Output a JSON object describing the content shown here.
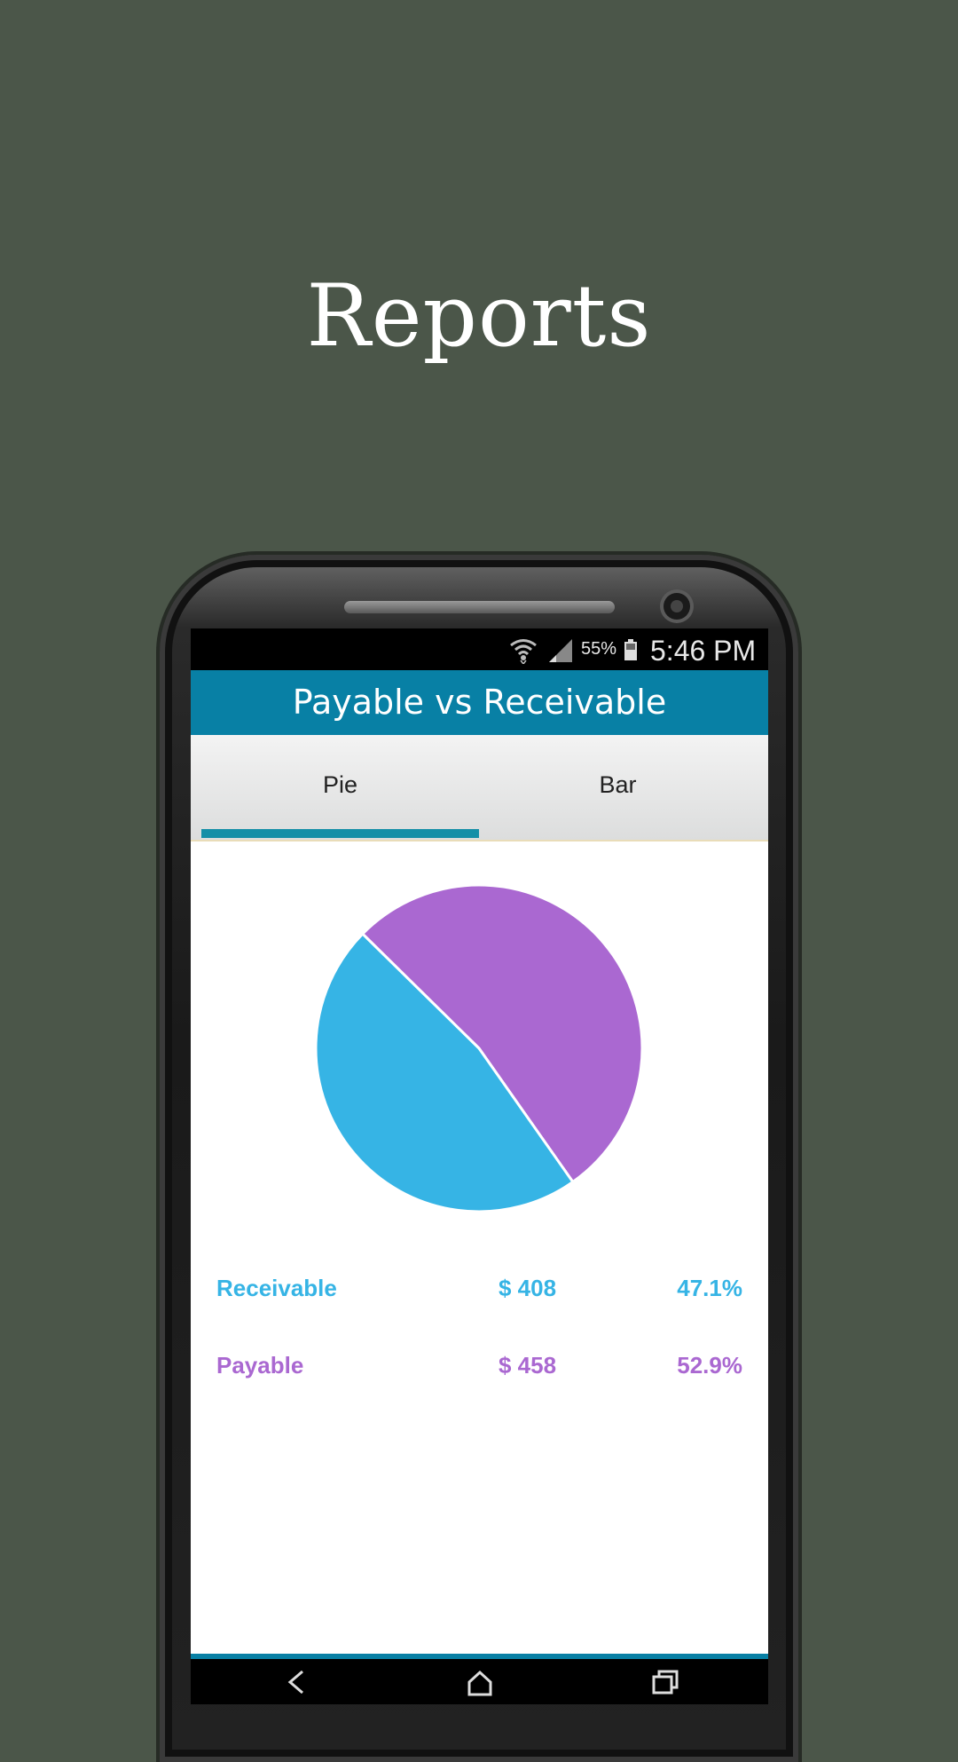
{
  "promo": {
    "title": "Reports"
  },
  "status_bar": {
    "battery": "55%",
    "time": "5:46 PM"
  },
  "app_bar": {
    "title": "Payable vs Receivable"
  },
  "tabs": [
    {
      "label": "Pie",
      "selected": true
    },
    {
      "label": "Bar",
      "selected": false
    }
  ],
  "colors": {
    "receivable": "#36b4e5",
    "payable": "#aa68d1",
    "app_bar": "#0880a5"
  },
  "legend": [
    {
      "name": "Receivable",
      "amount": "$ 408",
      "percent": "47.1%"
    },
    {
      "name": "Payable",
      "amount": "$ 458",
      "percent": "52.9%"
    }
  ],
  "chart_data": {
    "type": "pie",
    "categories": [
      "Receivable",
      "Payable"
    ],
    "values": [
      408,
      458
    ],
    "percentages": [
      47.1,
      52.9
    ],
    "colors": [
      "#36b4e5",
      "#aa68d1"
    ]
  },
  "icons": {
    "wifi": "wifi-icon",
    "signal": "signal-icon",
    "battery": "battery-icon",
    "back": "back-icon",
    "home": "home-icon",
    "recent": "recent-apps-icon"
  }
}
